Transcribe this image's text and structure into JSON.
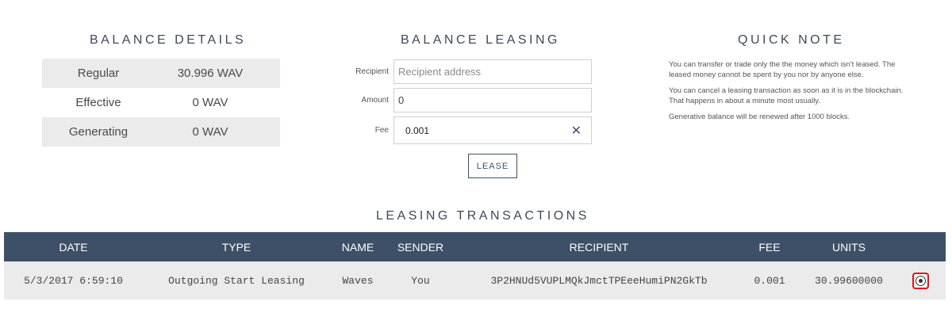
{
  "balance_details": {
    "title": "BALANCE DETAILS",
    "rows": [
      {
        "label": "Regular",
        "value": "30.996 WAV"
      },
      {
        "label": "Effective",
        "value": "0 WAV"
      },
      {
        "label": "Generating",
        "value": "0 WAV"
      }
    ]
  },
  "balance_leasing": {
    "title": "BALANCE LEASING",
    "recipient_label": "Recipient",
    "recipient_placeholder": "Recipient address",
    "amount_label": "Amount",
    "amount_value": "0",
    "fee_label": "Fee",
    "fee_value": "0.001",
    "clear_glyph": "✕",
    "lease_button": "LEASE"
  },
  "quick_note": {
    "title": "QUICK NOTE",
    "paragraphs": [
      "You can transfer or trade only the the money which isn't leased. The leased money cannot be spent by you nor by anyone else.",
      "You can cancel a leasing transaction as soon as it is in the blockchain. That happens in about a minute most usually.",
      "Generative balance will be renewed after 1000 blocks."
    ]
  },
  "leasing_transactions": {
    "title": "LEASING TRANSACTIONS",
    "columns": [
      "DATE",
      "TYPE",
      "NAME",
      "SENDER",
      "RECIPIENT",
      "FEE",
      "UNITS"
    ],
    "rows": [
      {
        "date": "5/3/2017 6:59:10",
        "type": "Outgoing Start Leasing",
        "name": "Waves",
        "sender": "You",
        "recipient": "3P2HNUd5VUPLMQkJmctTPEeeHumiPN2GkTb",
        "fee": "0.001",
        "units": "30.99600000",
        "action_icon": "transaction-details-icon"
      }
    ]
  },
  "colors": {
    "header_bg": "#3e5067",
    "highlight_border": "#e0121b",
    "shaded_row": "#ebebeb"
  }
}
